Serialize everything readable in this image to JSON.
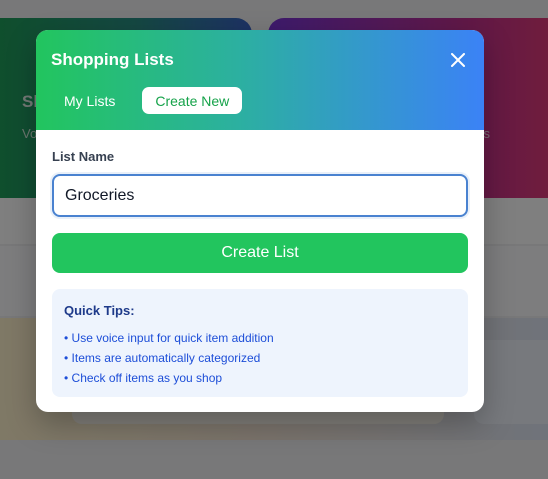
{
  "background": {
    "card1_title": "Sh",
    "card1_sub": "Vo",
    "card2_sub": "s"
  },
  "modal": {
    "title": "Shopping Lists",
    "close_icon": "close-icon",
    "tabs": [
      {
        "label": "My Lists",
        "active": false
      },
      {
        "label": "Create New",
        "active": true
      }
    ],
    "form": {
      "label": "List Name",
      "value": "Groceries",
      "submit_label": "Create List"
    },
    "tips": {
      "title": "Quick Tips:",
      "items": [
        "• Use voice input for quick item addition",
        "• Items are automatically categorized",
        "• Check off items as you shop"
      ]
    }
  },
  "colors": {
    "accent_green": "#22c55e",
    "accent_blue": "#3b82f6",
    "tips_bg": "#eef4fd",
    "tips_text": "#1d4ed8"
  }
}
